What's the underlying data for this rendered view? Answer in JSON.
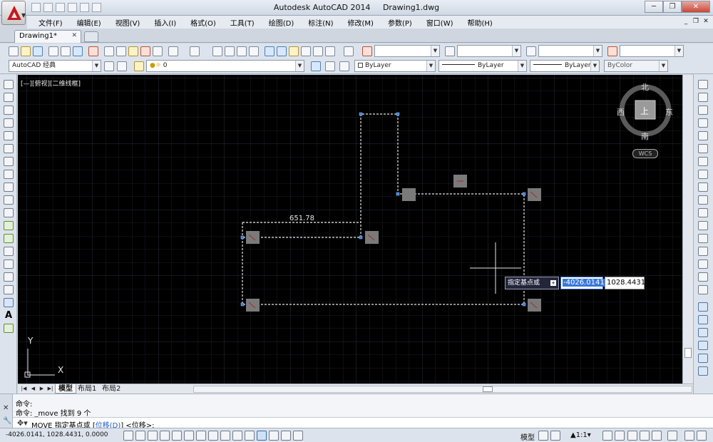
{
  "window": {
    "title": "Autodesk AutoCAD 2014",
    "doc_name": "Drawing1.dwg",
    "minimize": "─",
    "restore": "❐",
    "close": "✕"
  },
  "menu": [
    "文件(F)",
    "编辑(E)",
    "视图(V)",
    "插入(I)",
    "格式(O)",
    "工具(T)",
    "绘图(D)",
    "标注(N)",
    "修改(M)",
    "参数(P)",
    "窗口(W)",
    "帮助(H)"
  ],
  "mdi": {
    "minimize": "_",
    "restore": "❐",
    "close": "✕"
  },
  "doc_tab": {
    "label": "Drawing1*",
    "close": "✕"
  },
  "toolbar2": {
    "workspace": "AutoCAD 经典",
    "layer": "0",
    "color": "ByLayer",
    "linetype": "ByLayer",
    "lineweight": "ByLayer",
    "plotstyle": "ByColor"
  },
  "viewport_label": "[—][俯视][二维线框]",
  "compass": {
    "north": "北",
    "south": "南",
    "east": "东",
    "west": "西",
    "top": "上",
    "wcs": "WCS"
  },
  "ucs": {
    "x": "X",
    "y": "Y"
  },
  "dimension": "651.78",
  "dynamic_input": {
    "prompt": "指定基点或",
    "x_value": "-4026.0141",
    "y_value": "1028.4431"
  },
  "layout_tabs": [
    "模型",
    "布局1",
    "布局2"
  ],
  "command": {
    "history": [
      "命令:",
      "命令: _move 找到 9 个"
    ],
    "prompt_prefix": "MOVE 指定基点或 [",
    "option": "位移(D)",
    "prompt_suffix": "] <位移>:"
  },
  "status": {
    "coords": "-4026.0141, 1028.4431, 0.0000",
    "model": "模型",
    "scale": "1:1"
  }
}
